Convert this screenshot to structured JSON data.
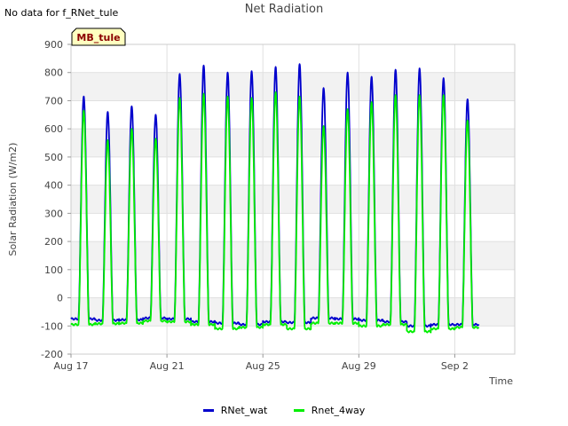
{
  "page": {
    "nodata_text": "No data for f_RNet_tule"
  },
  "chart_data": {
    "type": "line",
    "title": "Net Radiation",
    "xlabel": "Time",
    "ylabel": "Solar Radiation (W/m2)",
    "ylim": [
      -200,
      900
    ],
    "yticks": [
      -200,
      -100,
      0,
      100,
      200,
      300,
      400,
      500,
      600,
      700,
      800,
      900
    ],
    "xlim": [
      "2023-08-17",
      "2023-09-04"
    ],
    "xticks": [
      {
        "date": "2023-08-17",
        "label": "Aug 17"
      },
      {
        "date": "2023-08-21",
        "label": "Aug 21"
      },
      {
        "date": "2023-08-25",
        "label": "Aug 25"
      },
      {
        "date": "2023-08-29",
        "label": "Aug 29"
      },
      {
        "date": "2023-09-02",
        "label": "Sep 2"
      }
    ],
    "grid": true,
    "legend_position": "bottom",
    "annotation": "MB_tule",
    "daily_peak_dates": [
      "2023-08-17",
      "2023-08-18",
      "2023-08-19",
      "2023-08-20",
      "2023-08-21",
      "2023-08-22",
      "2023-08-23",
      "2023-08-24",
      "2023-08-25",
      "2023-08-26",
      "2023-08-27",
      "2023-08-28",
      "2023-08-29",
      "2023-08-30",
      "2023-08-31",
      "2023-09-01",
      "2023-09-02",
      "2023-09-03"
    ],
    "series": [
      {
        "name": "RNet_wat",
        "color": "#0000cc",
        "daily_peaks": [
          715,
          660,
          680,
          650,
          795,
          825,
          800,
          805,
          820,
          830,
          745,
          800,
          785,
          810,
          815,
          780,
          705,
          0
        ],
        "night_min": [
          -75,
          -80,
          -78,
          -72,
          -75,
          -85,
          -90,
          -95,
          -85,
          -88,
          -72,
          -75,
          -80,
          -85,
          -100,
          -95,
          -95,
          -85
        ]
      },
      {
        "name": "Rnet_4way",
        "color": "#00ee00",
        "daily_peaks": [
          665,
          560,
          600,
          565,
          710,
          725,
          715,
          710,
          730,
          715,
          610,
          670,
          695,
          720,
          720,
          720,
          630,
          0
        ],
        "night_min": [
          -95,
          -92,
          -90,
          -82,
          -85,
          -95,
          -110,
          -105,
          -95,
          -110,
          -90,
          -90,
          -100,
          -95,
          -120,
          -110,
          -105,
          -100
        ]
      }
    ]
  }
}
